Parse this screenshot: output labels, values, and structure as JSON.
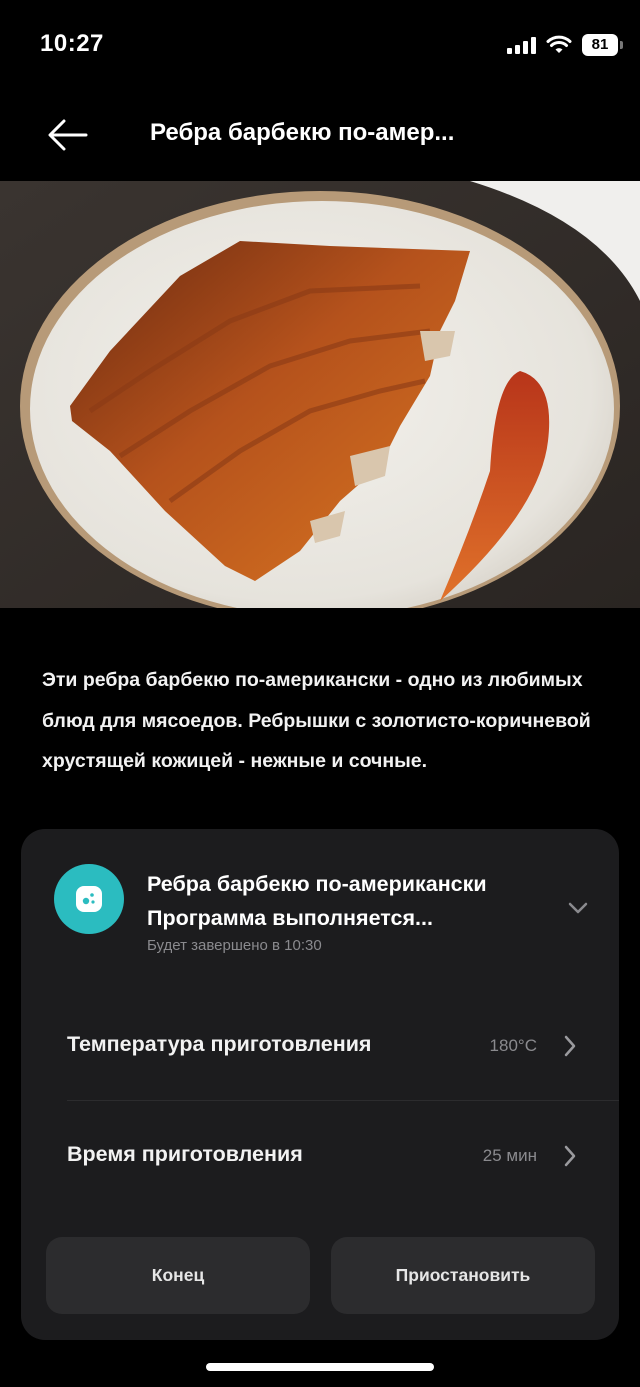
{
  "status_bar": {
    "time": "10:27",
    "battery": "81",
    "icons": [
      "signal-icon",
      "wifi-icon",
      "battery-icon"
    ]
  },
  "nav": {
    "title": "Ребра барбекю по-амер...",
    "back_icon": "back-arrow-icon"
  },
  "hero": {
    "image": "bbq-ribs-photo"
  },
  "description": "Эти ребра барбекю по-американски - одно из любимых блюд для мясоедов. Ребрышки с золотисто-коричневой хрустящей кожицей - нежные и сочные.",
  "program": {
    "title": "Ребра барбекю по-американски",
    "status": "Программа выполняется...",
    "eta": "Будет завершено в 10:30",
    "icon": "cooker-icon",
    "accent": "#2bbcc0"
  },
  "settings": [
    {
      "label": "Температура приготовления",
      "value": "180°C"
    },
    {
      "label": "Время приготовления",
      "value": "25 мин"
    }
  ],
  "buttons": {
    "end": "Конец",
    "pause": "Приостановить"
  }
}
